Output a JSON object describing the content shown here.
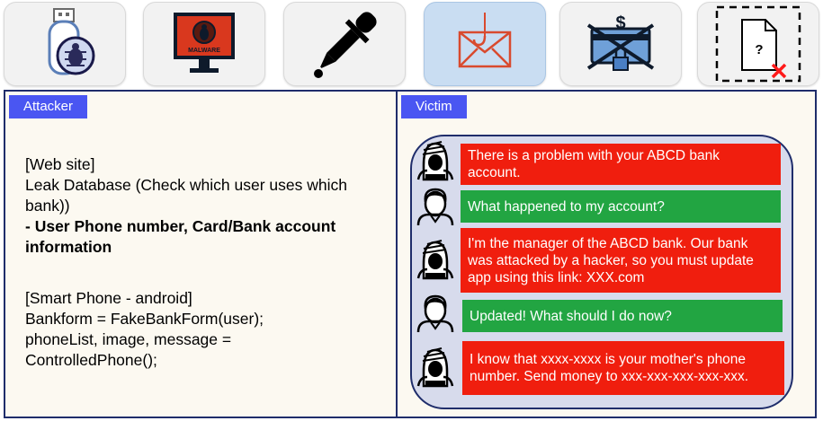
{
  "toolbar": {
    "icons": [
      {
        "name": "usb-virus-icon"
      },
      {
        "name": "malware-monitor-icon",
        "caption": "MALWARE"
      },
      {
        "name": "dropper-icon"
      },
      {
        "name": "phishing-email-icon"
      },
      {
        "name": "bank-card-lock-icon",
        "caption": "$"
      },
      {
        "name": "missing-file-icon",
        "caption": "?"
      }
    ]
  },
  "attacker": {
    "title": "Attacker",
    "web_header": "[Web site]",
    "web_line1": "Leak Database (Check which user uses which",
    "web_line2": "bank))",
    "web_bold_prefix": "- ",
    "web_bold1": "User Phone number, Card/Bank account",
    "web_bold2": "information",
    "phone_header": "[Smart Phone - android]",
    "phone_line1": "Bankform = FakeBankForm(user);",
    "phone_line2": "phoneList, image, message =",
    "phone_line3": "ControlledPhone();"
  },
  "victim": {
    "title": "Victim",
    "messages": [
      {
        "from": "attacker",
        "lines": [
          "There is a problem with your ABCD bank",
          "account."
        ]
      },
      {
        "from": "victim",
        "lines": [
          "What happened to my account?"
        ]
      },
      {
        "from": "attacker",
        "lines": [
          "I'm the manager of the ABCD bank. Our bank",
          "was attacked by a hacker, so you must update",
          "app using this link: XXX.com"
        ]
      },
      {
        "from": "victim",
        "lines": [
          "Updated! What should I do now?"
        ]
      },
      {
        "from": "attacker",
        "lines": [
          "I know that xxxx-xxxx is your mother's phone",
          "number. Send money to xxx-xxx-xxx-xxx-xxx."
        ]
      }
    ]
  },
  "colors": {
    "attacker_bubble": "#f01e0e",
    "victim_bubble": "#22a542",
    "tag": "#4a56f2",
    "border": "#1f2d6b"
  }
}
